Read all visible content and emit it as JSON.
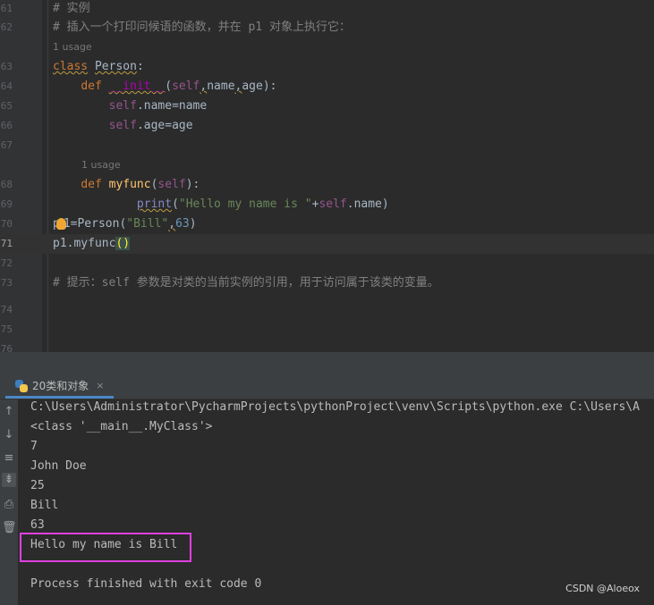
{
  "editor": {
    "lines": [
      {
        "num": "61",
        "comment": "# 实例"
      },
      {
        "num": "62",
        "comment": "# 插入一个打印问候语的函数，并在 p1 对象上执行它："
      },
      {
        "num": "63",
        "kw_class": "class",
        "class_name": "Person",
        "colon": ":"
      },
      {
        "num": "64",
        "kw_def": "def",
        "fn_name": "__init__",
        "params_open": "(",
        "p_self": "self",
        "c1": ",",
        "p_name": "name",
        "c2": ",",
        "p_age": "age",
        "params_close": "):"
      },
      {
        "num": "65",
        "self": "self",
        "attr": ".name",
        "eq": "=",
        "val": "name"
      },
      {
        "num": "66",
        "self": "self",
        "attr": ".age",
        "eq": "=",
        "val": "age"
      },
      {
        "num": "67"
      },
      {
        "num": "68",
        "kw_def": "def",
        "fn_name": "myfunc",
        "open": "(",
        "p_self": "self",
        "close": "):"
      },
      {
        "num": "69",
        "builtin": "print",
        "open": "(",
        "str": "\"Hello my name is \"",
        "plus": "+",
        "self": "self",
        "attr": ".name",
        "close": ")"
      },
      {
        "num": "70",
        "var_a": "p",
        "var_b": "1=Person(",
        "str": "\"Bill\"",
        "comma": ",",
        "num_val": "63",
        "close": ")"
      },
      {
        "num": "71",
        "call": "p1.myfunc",
        "parens": "()"
      },
      {
        "num": "72"
      },
      {
        "num": "73",
        "comment": "# 提示：self 参数是对类的当前实例的引用，用于访问属于该类的变量。"
      },
      {
        "num": "74"
      },
      {
        "num": "75"
      },
      {
        "num": "76"
      }
    ],
    "usage_hints": [
      "1 usage",
      "1 usage"
    ]
  },
  "run_panel": {
    "tab_label": "20类和对象",
    "tab_close": "×",
    "output": [
      "C:\\Users\\Administrator\\PycharmProjects\\pythonProject\\venv\\Scripts\\python.exe C:\\Users\\A",
      "<class '__main__.MyClass'>",
      "7",
      "John Doe",
      "25",
      "Bill",
      "63",
      "Hello my name is Bill",
      "",
      "Process finished with exit code 0"
    ],
    "toolbar_icons": [
      "arrow-up-icon",
      "arrow-down-icon",
      "soft-wrap-icon",
      "scroll-to-end-icon",
      "print-icon",
      "trash-icon"
    ]
  },
  "watermark": "CSDN @Aloeox"
}
